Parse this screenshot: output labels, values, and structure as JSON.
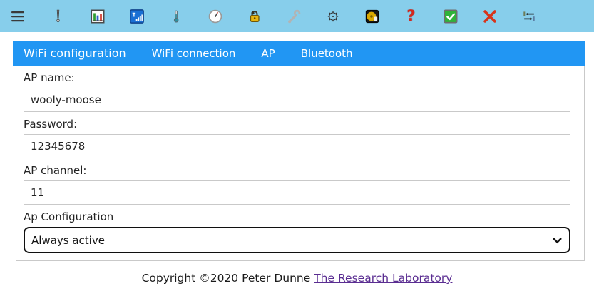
{
  "colors": {
    "toolbar_bg": "#87CEEB",
    "tabbar_bg": "#2196F3",
    "link": "#5A2D91"
  },
  "toolbar": {
    "question_glyph": "?",
    "icons": [
      "menu-icon",
      "exclamation-icon",
      "bar-chart-icon",
      "signal-strength-icon",
      "thermometer-icon",
      "clock-icon",
      "padlock-icon",
      "wrench-icon",
      "gear-icon",
      "minidisc-icon",
      "question-mark-icon",
      "checkbox-checked-icon",
      "red-x-icon",
      "swap-arrows-icon"
    ]
  },
  "tabs": {
    "items": [
      {
        "label": "WiFi configuration",
        "active": true
      },
      {
        "label": "WiFi connection",
        "active": false
      },
      {
        "label": "AP",
        "active": false
      },
      {
        "label": "Bluetooth",
        "active": false
      }
    ]
  },
  "form": {
    "ap_name": {
      "label": "AP name:",
      "value": "wooly-moose"
    },
    "password": {
      "label": "Password:",
      "value": "12345678"
    },
    "ap_channel": {
      "label": "AP channel:",
      "value": "11"
    },
    "ap_configuration": {
      "label": "Ap Configuration",
      "value": "Always active"
    }
  },
  "footer": {
    "copyright_text": "Copyright ©2020 Peter Dunne ",
    "link_label": "The Research Laboratory"
  }
}
